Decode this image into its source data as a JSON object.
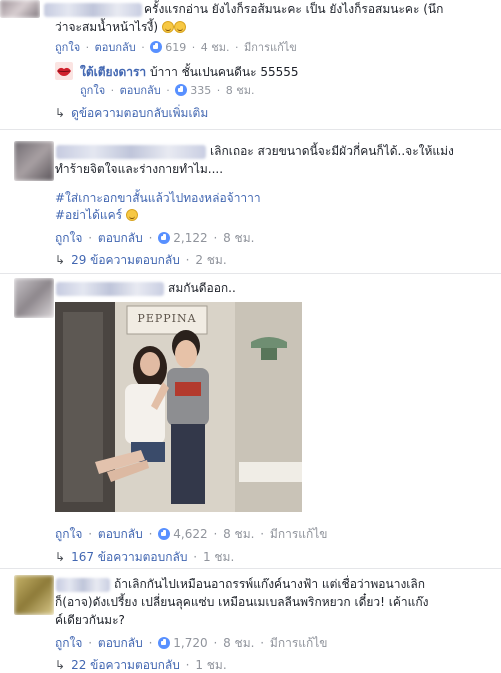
{
  "comment1": {
    "text_line1": "ครั้งแรกอ่าน ยังไงก็รอส้มนะคะ เป็น ยังไงก็รอสมนะคะ (นึก",
    "text_line2": "ว่าจะสมน้ำหน้าไรงี้)",
    "like_label": "ถูกใจ",
    "reply_label": "ตอบกลับ",
    "like_count": "619",
    "time": "4 ชม.",
    "edited": "มีการแก้ไข"
  },
  "reply1": {
    "author": "ใต้เตียงดารา",
    "text": "บ้าาา ชั้นเปนคนดีนะ 55555",
    "like_label": "ถูกใจ",
    "reply_label": "ตอบกลับ",
    "like_count": "335",
    "time": "8 ชม."
  },
  "more_replies1": "ดูข้อความตอบกลับเพิ่มเติม",
  "comment2": {
    "text_line1": "เลิกเถอะ สวยขนาดนี้จะมีผัวกี่คนก็ได้..จะให้แม่ง",
    "text_line2": "ทำร้ายจิตใจและร่างกายทำไม....",
    "hashtag1": "#ใส่เกาะอกขาสั้นแล้วไปทองหล่อจ้าาาา",
    "hashtag2": "#อย่าได้แคร์",
    "like_label": "ถูกใจ",
    "reply_label": "ตอบกลับ",
    "like_count": "2,122",
    "time": "8 ชม.",
    "replies": "29 ข้อความตอบกลับ",
    "replies_time": "2 ชม."
  },
  "comment3": {
    "text": "สมกันดีออก..",
    "photo_sign": "PEPPINA",
    "like_label": "ถูกใจ",
    "reply_label": "ตอบกลับ",
    "like_count": "4,622",
    "time": "8 ชม.",
    "edited": "มีการแก้ไข",
    "replies": "167 ข้อความตอบกลับ",
    "replies_time": "1 ชม."
  },
  "comment4": {
    "text_line1": "ถ้าเลิกกันไปเหมือนอาถรรพ์แก๊งค์นางฟ้า แต่เชื่อว่าพอนางเลิก",
    "text_line2": "ก็(อาจ)ดังเปรี้ยง เปลี่ยนลุคแซ่บ เหมือนเมเบลลีนพริกหยวก เดี๋ยว! เค้าแก๊ง",
    "text_line3": "ค์เดียวกันมะ?",
    "like_label": "ถูกใจ",
    "reply_label": "ตอบกลับ",
    "like_count": "1,720",
    "time": "8 ชม.",
    "edited": "มีการแก้ไข",
    "replies": "22 ข้อความตอบกลับ",
    "replies_time": "1 ชม."
  },
  "separator": "·",
  "colors": {
    "link": "#4267b2",
    "meta": "#90949c",
    "like": "#5890ff",
    "divider": "#e5e6e9"
  }
}
